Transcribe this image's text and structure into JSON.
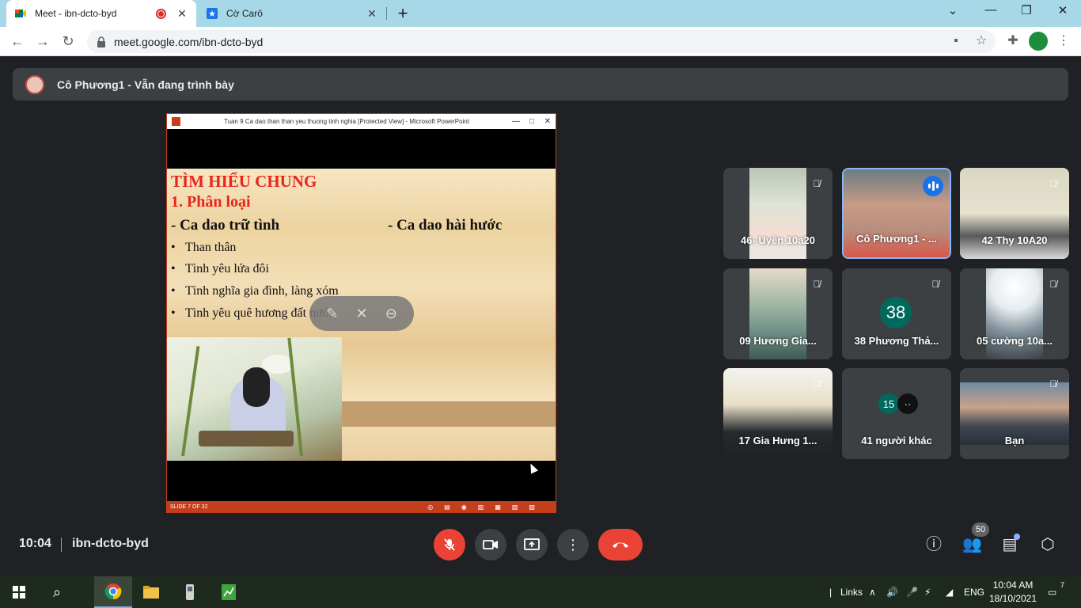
{
  "browser": {
    "tabs": [
      {
        "title": "Meet - ibn-dcto-byd",
        "active": true,
        "recording": true
      },
      {
        "title": "Cờ Carô",
        "active": false
      }
    ],
    "new_tab": "+",
    "url": "meet.google.com/ibn-dcto-byd",
    "icons": [
      "back-icon",
      "forward-icon",
      "reload-icon",
      "lock-icon",
      "camera-blocked-icon",
      "star-icon",
      "extensions-icon",
      "profile-avatar",
      "kebab-menu-icon"
    ]
  },
  "banner": {
    "presenter_text": "Cô Phương1 - Vẫn đang trình bày"
  },
  "ppt": {
    "window_title": "Tuan 9 Ca dao than than yeu thuong tinh nghia [Protected View] - Microsoft PowerPoint",
    "status": "SLIDE 7 OF 32",
    "slide": {
      "heading": "TÌM HIỂU CHUNG",
      "subheading": "1. Phân  loại",
      "col_left": "- Ca dao trữ tình",
      "col_right": "- Ca dao hài hước",
      "bullets": [
        "Than thân",
        "Tình yêu lứa đôi",
        "Tình nghĩa  gia đình, làng xóm",
        "Tình yêu quê hương đất nước"
      ]
    }
  },
  "participants": [
    {
      "name": "46- Uyên 10a20",
      "muted": true
    },
    {
      "name": "Cô Phương1 - ...",
      "speaking": true
    },
    {
      "name": "42 Thy 10A20",
      "muted": true
    },
    {
      "name": "09 Hương Gia...",
      "muted": true
    },
    {
      "name": "38 Phương Thả...",
      "initial": "38",
      "muted": true
    },
    {
      "name": "05 cường 10a...",
      "muted": true
    },
    {
      "name": "17 Gia Hưng 1...",
      "muted": true
    },
    {
      "name": "41 người khác",
      "mini": [
        "15",
        "··"
      ]
    },
    {
      "name": "Bạn",
      "muted": true
    }
  ],
  "meet": {
    "time": "10:04",
    "code": "ibn-dcto-byd",
    "people_count": "50",
    "accent": "#ea4335"
  },
  "taskbar": {
    "links_label": "Links",
    "lang": "ENG",
    "time": "10:04 AM",
    "date": "18/10/2021",
    "notif_count": "7"
  }
}
